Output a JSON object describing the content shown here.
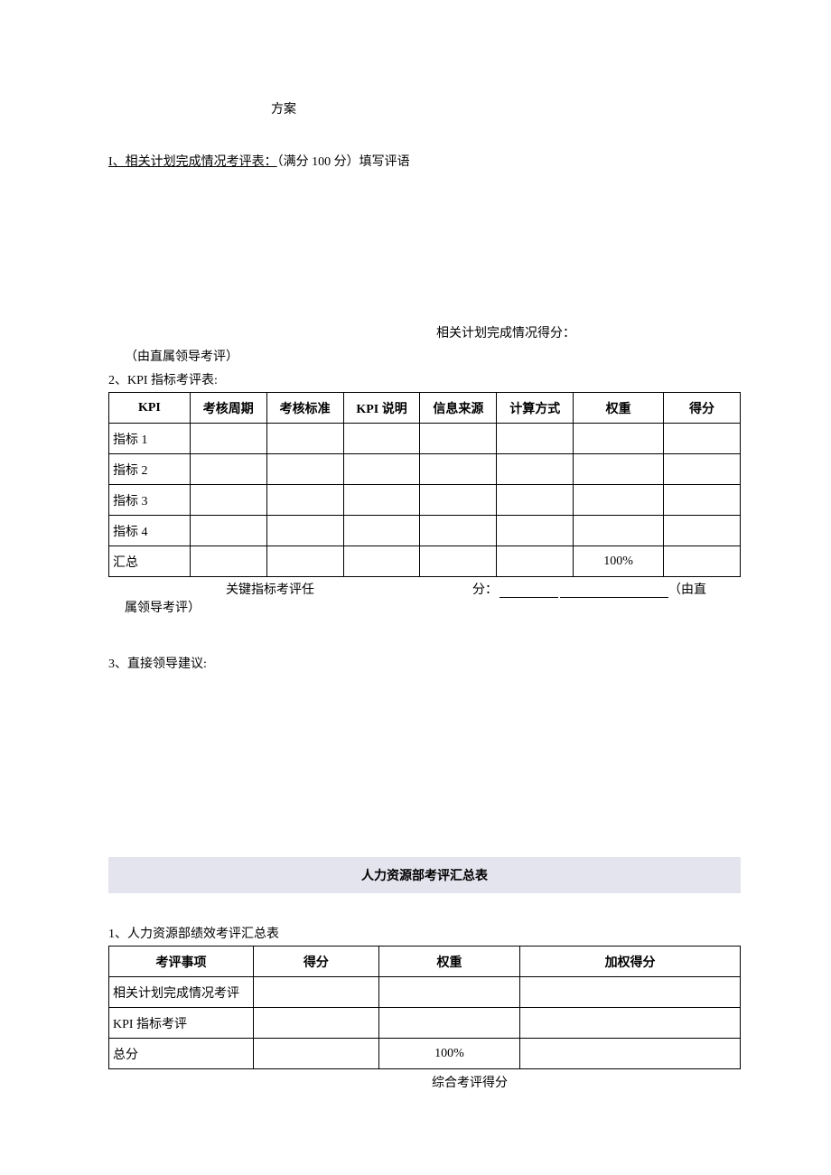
{
  "title_plan": "方案",
  "section1": {
    "prefix": "I、相关计划完成情况考评表：",
    "parenthetical": "（满分 100 分）填写评语"
  },
  "score_label": "相关计划完成情况得分：",
  "note1": "（由直属领导考评）",
  "section2_title": "2、KPI 指标考评表:",
  "kpi_headers": [
    "KPI",
    "考核周期",
    "考核标准",
    "KPI 说明",
    "信息来源",
    "计算方式",
    "权重",
    "得分"
  ],
  "kpi_rows": [
    {
      "label": "指标 1",
      "weight": ""
    },
    {
      "label": "指标 2",
      "weight": ""
    },
    {
      "label": "指标 3",
      "weight": ""
    },
    {
      "label": "指标 4",
      "weight": ""
    },
    {
      "label": "汇总",
      "weight": "100%"
    }
  ],
  "footer": {
    "a": "关键指标考评任",
    "b": "分：",
    "e": "（由直",
    "note": "属领导考评）"
  },
  "section3": "3、直接领导建议:",
  "hr_banner": "人力资源部考评汇总表",
  "section4_title": "1、人力资源部绩效考评汇总表",
  "summary_headers": [
    "考评事项",
    "得分",
    "权重",
    "加权得分"
  ],
  "summary_rows": [
    {
      "label": "相关计划完成情况考评",
      "weight": ""
    },
    {
      "label": "KPI 指标考评",
      "weight": ""
    },
    {
      "label": "总分",
      "weight": "100%"
    }
  ],
  "final_label": "综合考评得分"
}
